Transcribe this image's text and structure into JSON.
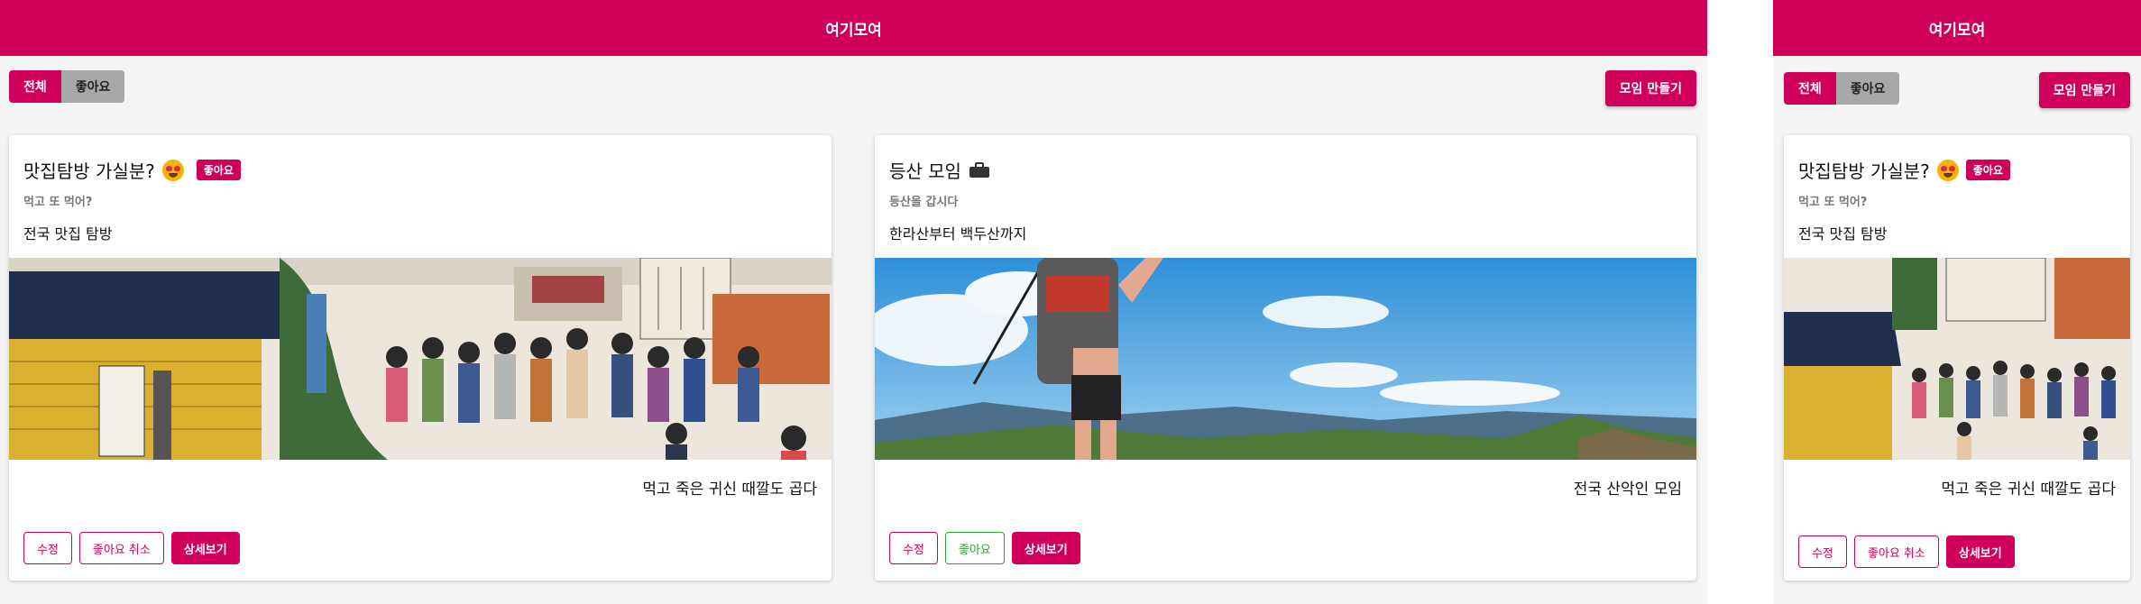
{
  "app": {
    "title": "여기모여",
    "brand_color": "#d0005a"
  },
  "filters": {
    "all_label": "전체",
    "liked_label": "좋아요"
  },
  "create_button_label": "모임 만들기",
  "cards": [
    {
      "title": "맛집탐방 가실분?",
      "title_icon": "star-struck-emoji-icon",
      "liked_badge": "좋아요",
      "subtitle": "먹고 또 먹어?",
      "description": "전국 맛집 탐방",
      "image": "street-food-illustration",
      "caption": "먹고 죽은 귀신 때깔도 곱다",
      "actions": {
        "edit": "수정",
        "like_toggle": "좋아요 취소",
        "detail": "상세보기"
      }
    },
    {
      "title": "등산 모임",
      "title_icon": "briefcase-icon",
      "subtitle": "등산을 갑시다",
      "description": "한라산부터 백두산까지",
      "image": "hiker-mountain-photo",
      "caption": "전국 산악인 모임",
      "actions": {
        "edit": "수정",
        "like_toggle": "좋아요",
        "detail": "상세보기"
      }
    }
  ]
}
